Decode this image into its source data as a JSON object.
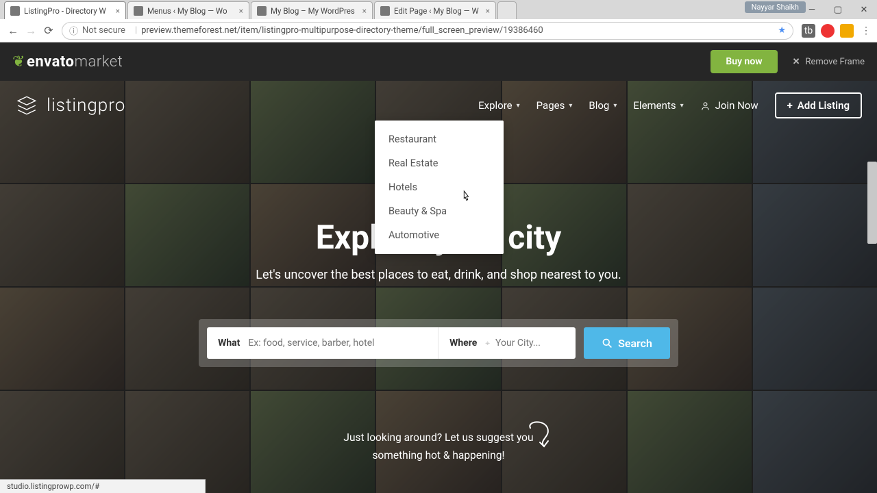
{
  "browser": {
    "tabs": [
      {
        "title": "ListingPro - Directory W",
        "active": true
      },
      {
        "title": "Menus ‹ My Blog — Wo",
        "active": false
      },
      {
        "title": "My Blog – My WordPres",
        "active": false
      },
      {
        "title": "Edit Page ‹ My Blog — W",
        "active": false
      }
    ],
    "profile_name": "Nayyar Shaikh",
    "security_label": "Not secure",
    "url": "preview.themeforest.net/item/listingpro-multipurpose-directory-theme/full_screen_preview/19386460",
    "status_bar": "studio.listingprowp.com/#"
  },
  "envato": {
    "brand_bold": "envato",
    "brand_light": "market",
    "buy_label": "Buy now",
    "remove_label": "Remove Frame"
  },
  "header": {
    "brand": "listingpro",
    "nav": {
      "explore": "Explore",
      "pages": "Pages",
      "blog": "Blog",
      "elements": "Elements"
    },
    "join_label": "Join Now",
    "add_listing_label": "Add Listing"
  },
  "dropdown": {
    "items": [
      "Restaurant",
      "Real Estate",
      "Hotels",
      "Beauty & Spa",
      "Automotive"
    ]
  },
  "hero": {
    "title": "Explore your city",
    "subtitle": "Let's uncover the best places to eat, drink, and shop nearest to you.",
    "suggest_line1": "Just looking around? Let us suggest you",
    "suggest_line2": "something hot & happening!"
  },
  "search": {
    "what_label": "What",
    "what_placeholder": "Ex: food, service, barber, hotel",
    "where_label": "Where",
    "where_placeholder": "Your City...",
    "button_label": "Search"
  }
}
